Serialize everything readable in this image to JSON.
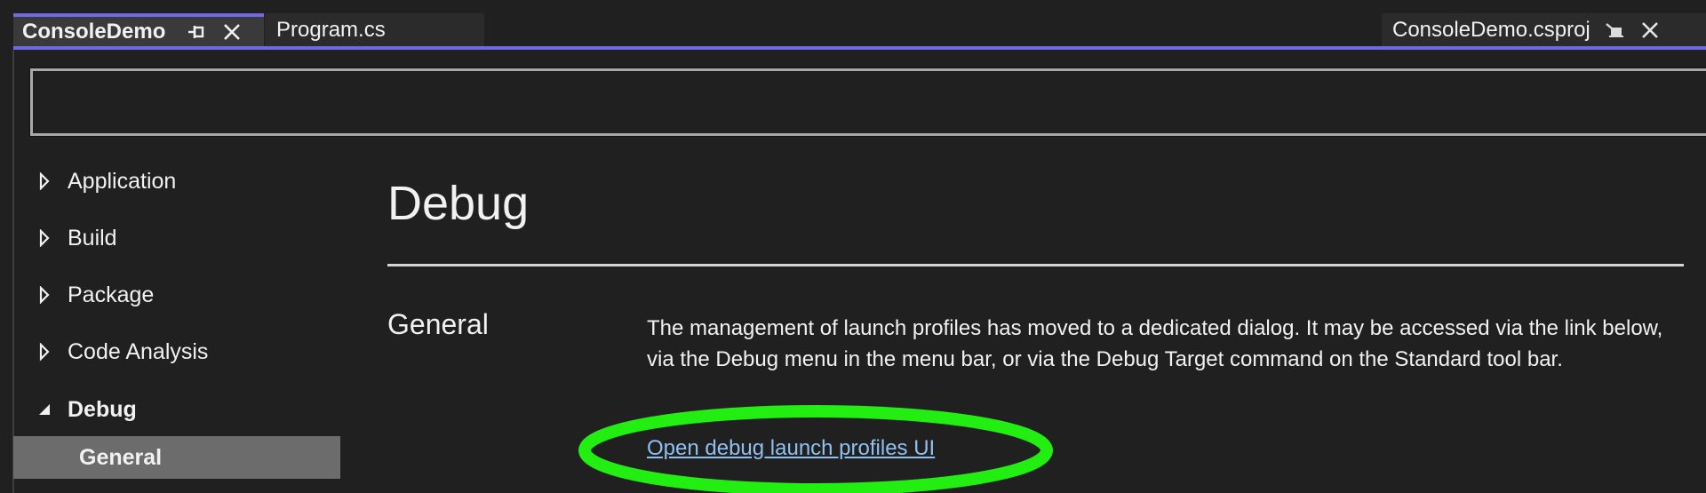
{
  "tabs": {
    "active": {
      "label": "ConsoleDemo",
      "pin_icon": "pin-icon",
      "close_icon": "close-icon"
    },
    "second": {
      "label": "Program.cs"
    },
    "right": {
      "label": "ConsoleDemo.csproj",
      "pin_icon": "unpinned-icon",
      "close_icon": "close-icon"
    }
  },
  "search": {
    "value": "",
    "placeholder": ""
  },
  "sidebar": {
    "items": [
      {
        "label": "Application",
        "state": "collapsed"
      },
      {
        "label": "Build",
        "state": "collapsed"
      },
      {
        "label": "Package",
        "state": "collapsed"
      },
      {
        "label": "Code Analysis",
        "state": "collapsed"
      },
      {
        "label": "Debug",
        "state": "expanded"
      },
      {
        "label": "General",
        "state": "selected"
      }
    ]
  },
  "main": {
    "title": "Debug",
    "section_label": "General",
    "description": "The management of launch profiles has moved to a dedicated dialog. It may be accessed via the link below, via the Debug menu in the menu bar, or via the Debug Target command on the Standard tool bar.",
    "link": "Open debug launch profiles UI"
  },
  "colors": {
    "accent": "#7267e4",
    "background": "#1f201f",
    "selected_row": "#6b6c6b",
    "link": "#8fc0f0",
    "annotation": "#22ee11"
  }
}
